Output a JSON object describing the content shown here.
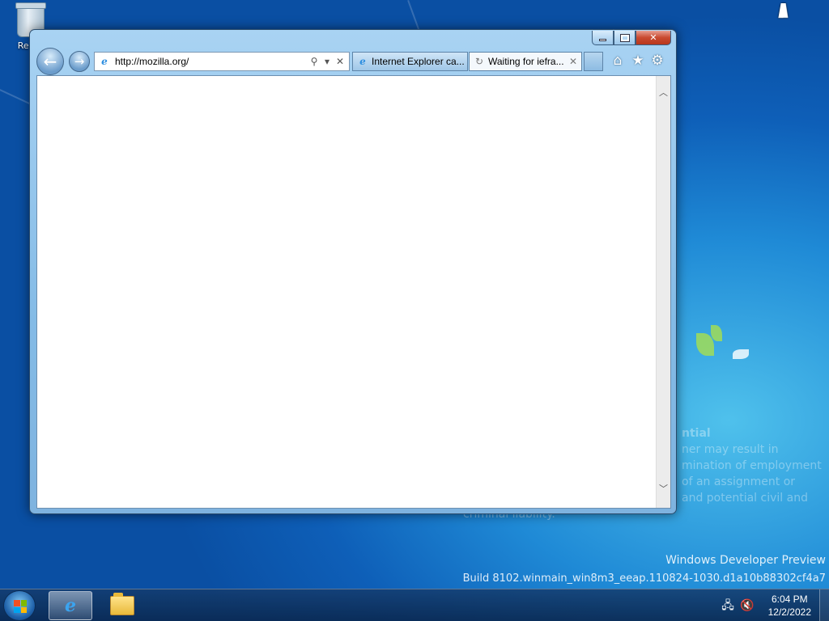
{
  "desktop": {
    "recycle_bin_label": "Recyc",
    "watermark": {
      "line1": "Windows Developer Preview",
      "line2": "Build 8102.winmain_win8m3_eeap.110824-1030.d1a10b88302cf4a7"
    },
    "behind_text": {
      "line1": "ntial",
      "line2": "ner may result in",
      "line3": "mination of employment",
      "line4": "of an assignment or",
      "line5": "and potential civil and",
      "line6": "criminal liability."
    }
  },
  "browser": {
    "address_bar": {
      "url": "http://mozilla.org/",
      "site_icon": "ie-icon"
    },
    "tabs": [
      {
        "label": "Internet Explorer ca...",
        "icon": "ie-icon",
        "active": false
      },
      {
        "label": "Waiting for iefra...",
        "icon": "loading-spinner-icon",
        "active": true
      }
    ],
    "toolbar_icons": [
      "home-icon",
      "favorites-star-icon",
      "settings-gear-icon"
    ],
    "caption_buttons": [
      "minimize",
      "maximize",
      "close"
    ]
  },
  "taskbar": {
    "clock": {
      "time": "6:04 PM",
      "date": "12/2/2022"
    },
    "pinned": [
      "internet-explorer",
      "windows-explorer"
    ],
    "tray_icons": [
      "network-disconnected-icon",
      "volume-muted-icon"
    ]
  },
  "colors": {
    "desktop_bg": "#1f8ad6",
    "window_frame": "#84bbe6",
    "close_button": "#c94a30"
  }
}
